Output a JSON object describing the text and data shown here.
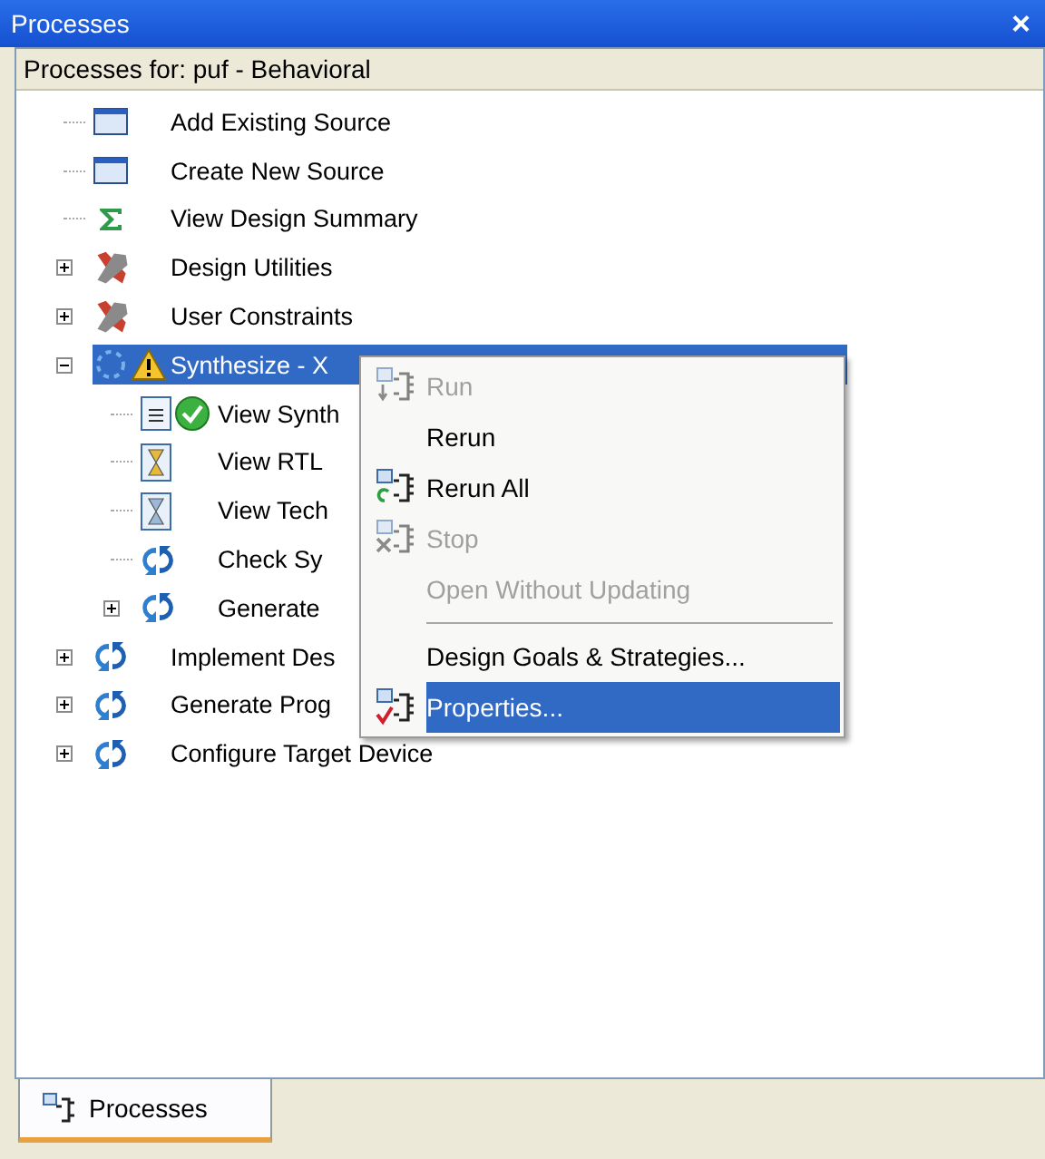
{
  "window": {
    "title": "Processes",
    "close": "×"
  },
  "header": "Processes for: puf - Behavioral",
  "tree": {
    "items": [
      {
        "label": "Add Existing Source",
        "kind": "window",
        "selected": false
      },
      {
        "label": "Create New Source",
        "kind": "window",
        "selected": false
      },
      {
        "label": "View Design Summary",
        "kind": "sigma",
        "selected": false
      },
      {
        "label": "Design Utilities",
        "kind": "tools",
        "selected": false,
        "expanded": false
      },
      {
        "label": "User Constraints",
        "kind": "tools",
        "selected": false,
        "expanded": false
      },
      {
        "label": "Synthesize - X",
        "kind": "running-warning",
        "selected": true,
        "expanded": true,
        "children": [
          {
            "label": "View Synth",
            "kind": "report-ok",
            "selected": false
          },
          {
            "label": "View RTL",
            "kind": "hourglass-gold",
            "selected": false
          },
          {
            "label": "View Tech",
            "kind": "hourglass-blue",
            "selected": false
          },
          {
            "label": "Check Sy",
            "kind": "cycle",
            "selected": false
          },
          {
            "label": "Generate",
            "kind": "cycle",
            "selected": false,
            "expanded": false
          }
        ]
      },
      {
        "label": "Implement Des",
        "kind": "cycle",
        "selected": false,
        "expanded": false
      },
      {
        "label": "Generate Prog",
        "kind": "cycle",
        "selected": false,
        "expanded": false
      },
      {
        "label": "Configure Target Device",
        "kind": "cycle",
        "selected": false,
        "expanded": false
      }
    ]
  },
  "context_menu": {
    "items": [
      {
        "kind": "run",
        "label": "Run",
        "disabled": true,
        "selected": false
      },
      {
        "kind": "plain",
        "label": "Rerun",
        "disabled": false,
        "selected": false
      },
      {
        "kind": "rerun",
        "label": "Rerun All",
        "disabled": false,
        "selected": false
      },
      {
        "kind": "stop",
        "label": "Stop",
        "disabled": true,
        "selected": false
      },
      {
        "kind": "plain",
        "label": "Open Without Updating",
        "disabled": true,
        "selected": false
      },
      {
        "kind": "separator"
      },
      {
        "kind": "plain",
        "label": "Design Goals & Strategies...",
        "disabled": false,
        "selected": false
      },
      {
        "kind": "properties",
        "label": "Properties...",
        "disabled": false,
        "selected": true
      }
    ]
  },
  "tabs": [
    {
      "label": "Processes",
      "selected": true
    }
  ]
}
